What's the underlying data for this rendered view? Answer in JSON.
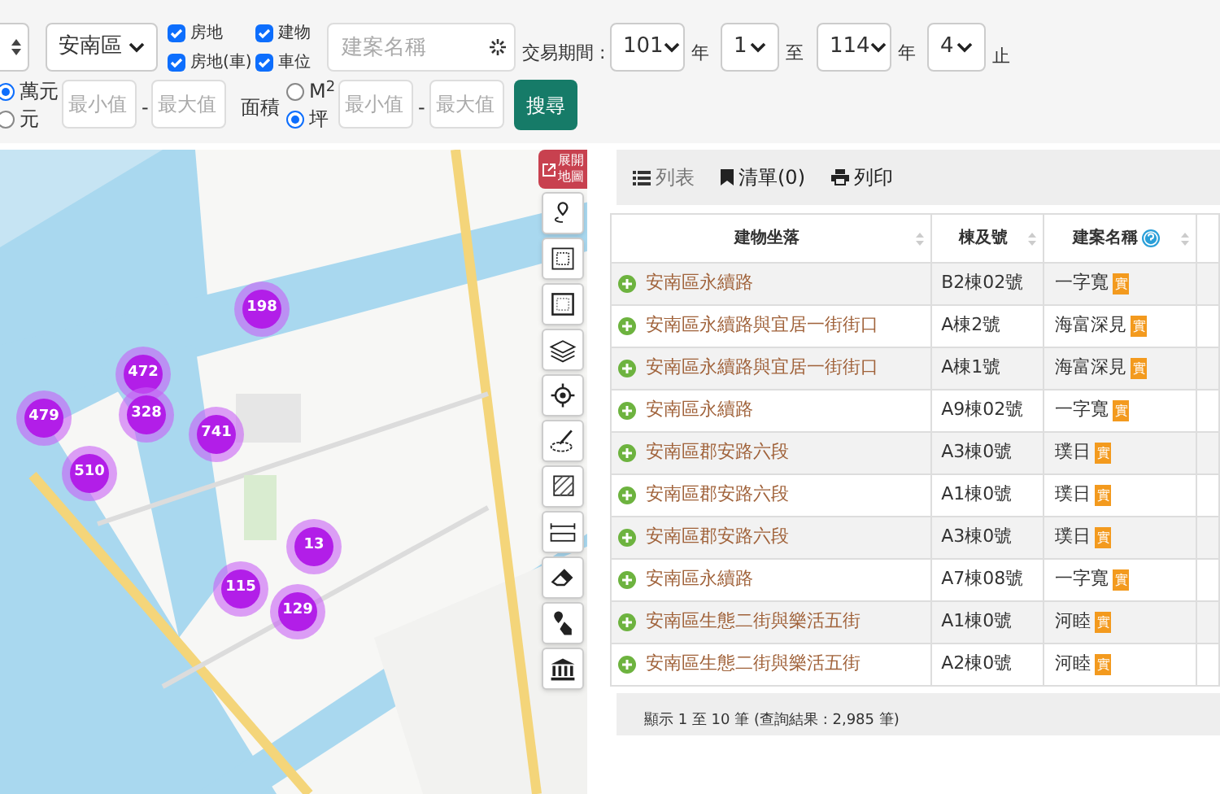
{
  "filters": {
    "district_select": {
      "value": "安南區"
    },
    "types": [
      {
        "label": "房地",
        "checked": true
      },
      {
        "label": "建物",
        "checked": true
      },
      {
        "label": "房地(車)",
        "checked": true
      },
      {
        "label": "車位",
        "checked": true
      }
    ],
    "project_search": {
      "placeholder": "建案名稱"
    },
    "period": {
      "label": "交易期間 :",
      "start_year": "101",
      "year_unit_1": "年",
      "start_month": "1",
      "to": "至",
      "end_year": "114",
      "year_unit_2": "年",
      "end_month": "4",
      "until": "止"
    },
    "price_units": [
      {
        "label": "萬元",
        "selected": true
      },
      {
        "label": "元",
        "selected": false
      }
    ],
    "price_min": {
      "placeholder": "最小值"
    },
    "price_sep": "-",
    "price_max": {
      "placeholder": "最大值"
    },
    "area_label": "面積",
    "area_units": [
      {
        "label": "M$^{2}$",
        "selected": false
      },
      {
        "label": "坪",
        "selected": true
      }
    ],
    "area_min": {
      "placeholder": "最小值"
    },
    "area_sep": "-",
    "area_max": {
      "placeholder": "最大值"
    },
    "search_button": "搜尋"
  },
  "map": {
    "kind": "picture",
    "expand_button": [
      "展開",
      "地圖"
    ],
    "tools": [
      {
        "kind": "pin-route"
      },
      {
        "kind": "dotted-square"
      },
      {
        "kind": "square"
      },
      {
        "kind": "layers"
      },
      {
        "kind": "target"
      },
      {
        "kind": "pen"
      },
      {
        "kind": "hatch"
      },
      {
        "kind": "ruler"
      },
      {
        "kind": "eraser"
      },
      {
        "kind": "pin-hand"
      },
      {
        "kind": "bank"
      }
    ],
    "clusters": [
      {
        "count": "198"
      },
      {
        "count": "472"
      },
      {
        "count": "328"
      },
      {
        "count": "741"
      },
      {
        "count": "479"
      },
      {
        "count": "510"
      },
      {
        "count": "13"
      },
      {
        "count": "115"
      },
      {
        "count": "129"
      }
    ]
  },
  "toolbar": [
    {
      "kind": "list",
      "label": "列表"
    },
    {
      "kind": "bookmark",
      "label": "清單(0)"
    },
    {
      "kind": "print",
      "label": "列印"
    }
  ],
  "table": {
    "columns": [
      "建物坐落",
      "棟及號",
      "建案名稱"
    ],
    "rows": [
      {
        "location": "安南區永續路",
        "unit": "B2棟02號",
        "project": "一字寬",
        "badge": "實"
      },
      {
        "location": "安南區永續路與宜居一街街口",
        "unit": "A棟2號",
        "project": "海富深見",
        "badge": "實"
      },
      {
        "location": "安南區永續路與宜居一街街口",
        "unit": "A棟1號",
        "project": "海富深見",
        "badge": "實"
      },
      {
        "location": "安南區永續路",
        "unit": "A9棟02號",
        "project": "一字寬",
        "badge": "實"
      },
      {
        "location": "安南區郡安路六段",
        "unit": "A3棟0號",
        "project": "璞日",
        "badge": "實"
      },
      {
        "location": "安南區郡安路六段",
        "unit": "A1棟0號",
        "project": "璞日",
        "badge": "實"
      },
      {
        "location": "安南區郡安路六段",
        "unit": "A3棟0號",
        "project": "璞日",
        "badge": "實"
      },
      {
        "location": "安南區永續路",
        "unit": "A7棟08號",
        "project": "一字寬",
        "badge": "實"
      },
      {
        "location": "安南區生態二街與樂活五街",
        "unit": "A1棟0號",
        "project": "河睦",
        "badge": "實"
      },
      {
        "location": "安南區生態二街與樂活五街",
        "unit": "A2棟0號",
        "project": "河睦",
        "badge": "實"
      }
    ],
    "footer": "顯示 1 至 10 筆 (查詢結果 : 2,985 筆)"
  }
}
